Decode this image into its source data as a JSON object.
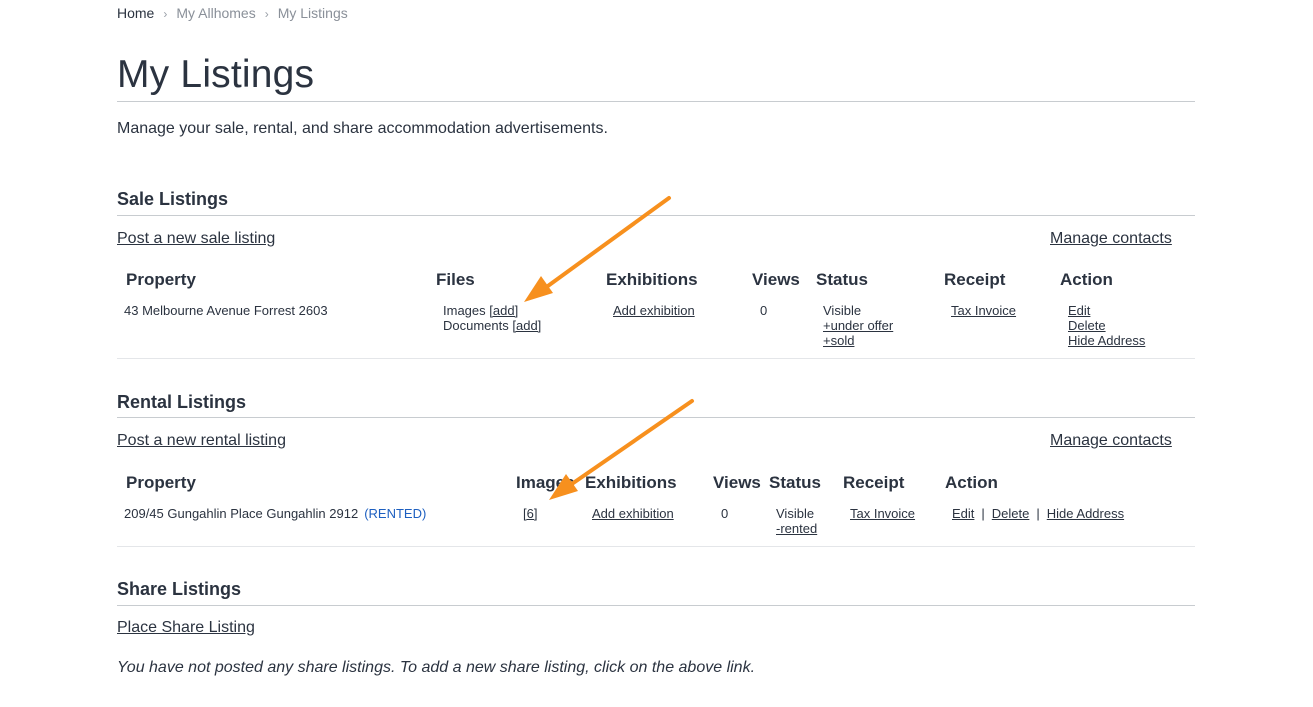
{
  "breadcrumb": {
    "home": "Home",
    "my_allhomes": "My Allhomes",
    "current": "My Listings"
  },
  "page": {
    "title": "My Listings",
    "intro": "Manage your sale, rental, and share accommodation advertisements."
  },
  "sale": {
    "heading": "Sale Listings",
    "post_link": "Post a new sale listing",
    "manage_contacts": "Manage contacts",
    "columns": {
      "property": "Property",
      "files": "Files",
      "exhibitions": "Exhibitions",
      "views": "Views",
      "status": "Status",
      "receipt": "Receipt",
      "action": "Action"
    },
    "row": {
      "property": "43 Melbourne Avenue Forrest 2603",
      "images_label": "Images",
      "images_add": "[add]",
      "documents_label": "Documents",
      "documents_add": "[add]",
      "exhibition": "Add exhibition",
      "views": "0",
      "status": "Visible",
      "status_under_offer": "+under offer",
      "status_sold": "+sold",
      "receipt": "Tax Invoice",
      "edit": "Edit",
      "delete": "Delete",
      "hide_address": "Hide Address"
    }
  },
  "rental": {
    "heading": "Rental Listings",
    "post_link": "Post a new rental listing",
    "manage_contacts": "Manage contacts",
    "columns": {
      "property": "Property",
      "images": "Images",
      "exhibitions": "Exhibitions",
      "views": "Views",
      "status": "Status",
      "receipt": "Receipt",
      "action": "Action"
    },
    "row": {
      "property": "209/45 Gungahlin Place Gungahlin 2912",
      "rented_tag": "(RENTED)",
      "images": "[6]",
      "exhibition": "Add exhibition",
      "views": "0",
      "status": "Visible",
      "status_rented": "-rented",
      "receipt": "Tax Invoice",
      "edit": "Edit",
      "pipe": "|",
      "delete": "Delete",
      "hide_address": "Hide Address"
    }
  },
  "share": {
    "heading": "Share Listings",
    "place_link": "Place Share Listing",
    "empty_message": "You have not posted any share listings. To add a new share listing, click on the above link."
  },
  "colors": {
    "text": "#2b3340",
    "rented": "#1d5fc0",
    "arrow": "#f7901e",
    "rule": "#c8ccd0"
  },
  "icons": {
    "breadcrumb_separator": "chevron-right-icon",
    "annotation": "arrow-icon"
  }
}
